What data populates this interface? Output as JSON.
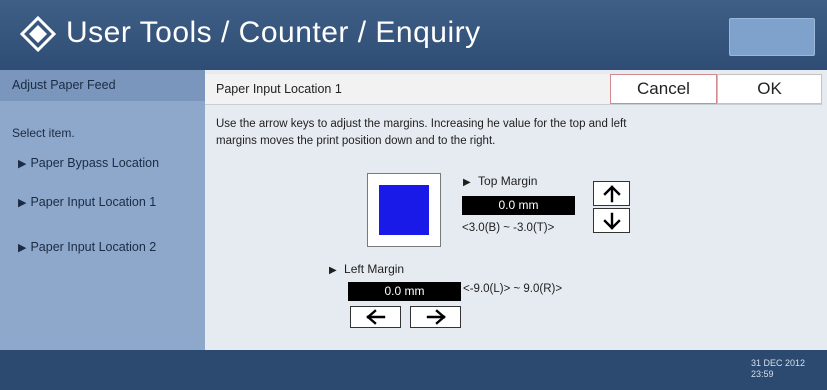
{
  "header": {
    "title": "User Tools / Counter / Enquiry",
    "top_button": ""
  },
  "sidebar": {
    "heading": "Adjust Paper Feed",
    "select_label": "Select item.",
    "items": [
      {
        "label": "Paper Bypass Location"
      },
      {
        "label": "Paper Input Location 1"
      },
      {
        "label": "Paper Input Location 2"
      }
    ]
  },
  "panel": {
    "title": "Paper Input Location 1",
    "cancel_label": "Cancel",
    "ok_label": "OK",
    "instructions": "Use the arrow keys to adjust the margins. Increasing he value for the top and left margins moves the print position down and to the right."
  },
  "top_margin": {
    "label": "Top Margin",
    "value": "0.0 mm",
    "range": "<3.0(B) ~ -3.0(T)>"
  },
  "left_margin": {
    "label": "Left Margin",
    "value": "0.0 mm",
    "range": "<-9.0(L)> ~ 9.0(R)>"
  },
  "footer": {
    "date": "31 DEC 2012",
    "time": "23:59"
  },
  "colors": {
    "preview_square": "#1a1ae8",
    "header": "#3f5f86",
    "sidebar": "#8ea8cc"
  }
}
